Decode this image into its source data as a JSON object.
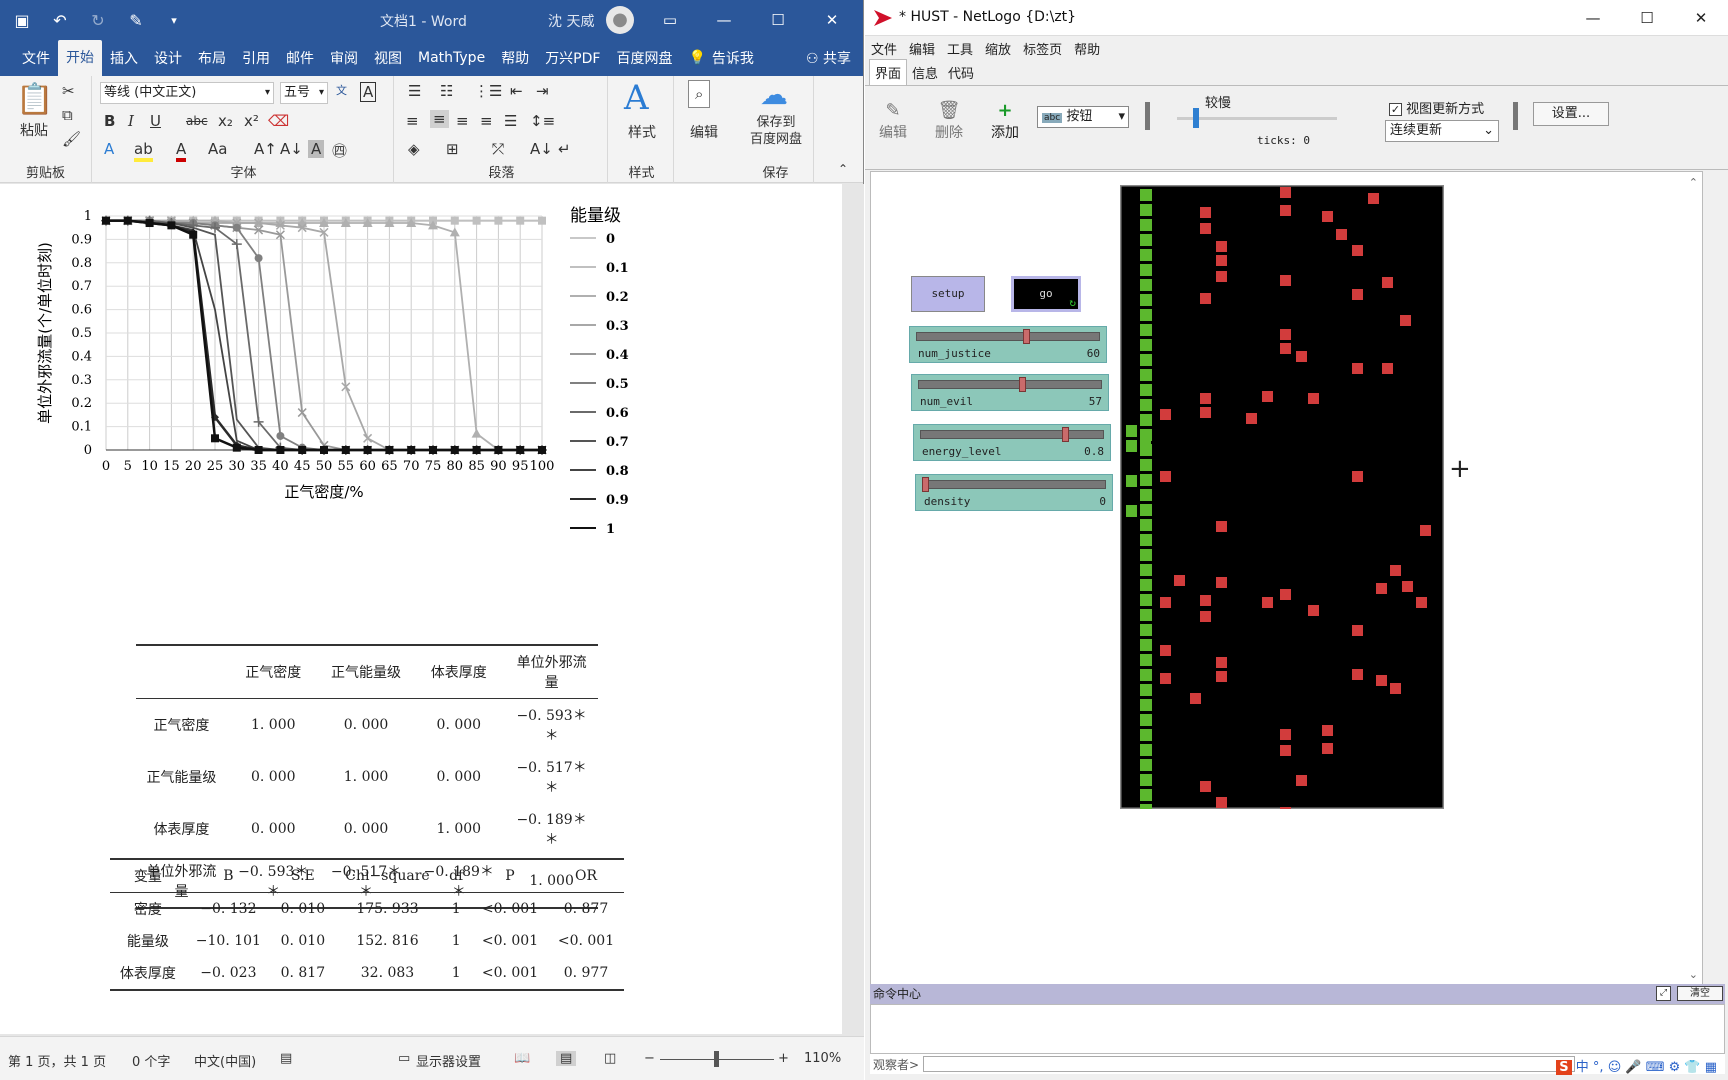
{
  "word": {
    "title": "文档1 - Word",
    "user": "沈 天威",
    "tabs": [
      "文件",
      "开始",
      "插入",
      "设计",
      "布局",
      "引用",
      "邮件",
      "审阅",
      "视图",
      "MathType",
      "帮助",
      "万兴PDF",
      "百度网盘"
    ],
    "tellme": "告诉我",
    "share": "共享",
    "font_name": "等线 (中文正文)",
    "font_size": "五号",
    "groups": {
      "clipboard": "剪贴板",
      "font": "字体",
      "paragraph": "段落",
      "styles": "样式",
      "save": "保存"
    },
    "paste": "粘贴",
    "styles_btn": "样式",
    "edit_btn": "编辑",
    "save_to_baidu": "保存到\n百度网盘",
    "status": {
      "page": "第 1 页，共 1 页",
      "words": "0 个字",
      "lang": "中文(中国)",
      "display": "显示器设置",
      "zoom": "110%"
    }
  },
  "chart_data": {
    "type": "line",
    "x": [
      0,
      5,
      10,
      15,
      20,
      25,
      30,
      35,
      40,
      45,
      50,
      55,
      60,
      65,
      70,
      75,
      80,
      85,
      90,
      95,
      100
    ],
    "xlabel": "正气密度/%",
    "ylabel": "单位外邪流量(个/单位时刻)",
    "ylim": [
      0,
      1
    ],
    "yticks": [
      "0",
      "0.1",
      "0.2",
      "0.3",
      "0.4",
      "0.5",
      "0.6",
      "0.7",
      "0.8",
      "0.9",
      "1"
    ],
    "legend_title": "能量级",
    "legend_position": "right",
    "series": [
      {
        "name": "0",
        "color": "#c8c8c8",
        "values": [
          0.98,
          0.98,
          0.98,
          0.98,
          0.98,
          0.98,
          0.98,
          0.98,
          0.98,
          0.98,
          0.98,
          0.98,
          0.98,
          0.98,
          0.98,
          0.98,
          0.98,
          0.98,
          0.98,
          0.98,
          0.98
        ]
      },
      {
        "name": "0.1",
        "color": "#c0c0c0",
        "values": [
          0.98,
          0.98,
          0.98,
          0.98,
          0.98,
          0.98,
          0.98,
          0.98,
          0.98,
          0.98,
          0.98,
          0.98,
          0.98,
          0.98,
          0.98,
          0.98,
          0.98,
          0.98,
          0.98,
          0.98,
          0.98
        ]
      },
      {
        "name": "0.2",
        "color": "#b0b0b0",
        "values": [
          0.98,
          0.98,
          0.98,
          0.98,
          0.98,
          0.98,
          0.97,
          0.97,
          0.97,
          0.97,
          0.97,
          0.97,
          0.97,
          0.97,
          0.97,
          0.96,
          0.93,
          0.07,
          0,
          0,
          0
        ]
      },
      {
        "name": "0.3",
        "color": "#a8a8a8",
        "values": [
          0.98,
          0.98,
          0.98,
          0.98,
          0.97,
          0.97,
          0.97,
          0.97,
          0.96,
          0.95,
          0.93,
          0.27,
          0.05,
          0,
          0,
          0,
          0,
          0,
          0,
          0,
          0
        ]
      },
      {
        "name": "0.4",
        "color": "#999999",
        "values": [
          0.98,
          0.98,
          0.98,
          0.97,
          0.97,
          0.96,
          0.95,
          0.94,
          0.92,
          0.16,
          0.02,
          0,
          0,
          0,
          0,
          0,
          0,
          0,
          0,
          0,
          0
        ]
      },
      {
        "name": "0.5",
        "color": "#808080",
        "values": [
          0.98,
          0.98,
          0.98,
          0.97,
          0.97,
          0.96,
          0.95,
          0.82,
          0.06,
          0.01,
          0,
          0,
          0,
          0,
          0,
          0,
          0,
          0,
          0,
          0,
          0
        ]
      },
      {
        "name": "0.6",
        "color": "#6a6a6a",
        "values": [
          0.98,
          0.98,
          0.98,
          0.97,
          0.96,
          0.95,
          0.88,
          0.12,
          0.01,
          0,
          0,
          0,
          0,
          0,
          0,
          0,
          0,
          0,
          0,
          0,
          0
        ]
      },
      {
        "name": "0.7",
        "color": "#555555",
        "values": [
          0.98,
          0.98,
          0.97,
          0.97,
          0.95,
          0.92,
          0.13,
          0.01,
          0,
          0,
          0,
          0,
          0,
          0,
          0,
          0,
          0,
          0,
          0,
          0,
          0
        ]
      },
      {
        "name": "0.8",
        "color": "#444444",
        "values": [
          0.98,
          0.98,
          0.97,
          0.96,
          0.94,
          0.6,
          0.04,
          0,
          0,
          0,
          0,
          0,
          0,
          0,
          0,
          0,
          0,
          0,
          0,
          0,
          0
        ]
      },
      {
        "name": "0.9",
        "color": "#2a2a2a",
        "values": [
          0.98,
          0.98,
          0.97,
          0.96,
          0.93,
          0.14,
          0.02,
          0,
          0,
          0,
          0,
          0,
          0,
          0,
          0,
          0,
          0,
          0,
          0,
          0,
          0
        ]
      },
      {
        "name": "1",
        "color": "#111111",
        "values": [
          0.98,
          0.98,
          0.97,
          0.96,
          0.92,
          0.05,
          0.01,
          0,
          0,
          0,
          0,
          0,
          0,
          0,
          0,
          0,
          0,
          0,
          0,
          0,
          0
        ]
      }
    ]
  },
  "table1": {
    "headers": [
      "",
      "正气密度",
      "正气能量级",
      "体表厚度",
      "单位外邪流量"
    ],
    "rows": [
      [
        "正气密度",
        "1. 000",
        "0. 000",
        "0. 000",
        "−0. 593＊＊"
      ],
      [
        "正气能量级",
        "0. 000",
        "1. 000",
        "0. 000",
        "−0. 517＊＊"
      ],
      [
        "体表厚度",
        "0. 000",
        "0. 000",
        "1. 000",
        "−0. 189＊＊"
      ],
      [
        "单位外邪流量",
        "−0. 593＊＊",
        "−0. 517＊＊",
        "−0. 189＊＊",
        "1. 000"
      ]
    ]
  },
  "table2": {
    "headers": [
      "变量",
      "B",
      "S.E",
      "Chi−square",
      "df",
      "P",
      "OR"
    ],
    "rows": [
      [
        "密度",
        "−0. 132",
        "0. 010",
        "175. 933",
        "1",
        "<0. 001",
        "0. 877"
      ],
      [
        "能量级",
        "−10. 101",
        "0. 010",
        "152. 816",
        "1",
        "<0. 001",
        "<0. 001"
      ],
      [
        "体表厚度",
        "−0. 023",
        "0. 817",
        "32. 083",
        "1",
        "<0. 001",
        "0. 977"
      ]
    ]
  },
  "netlogo": {
    "title": "* HUST - NetLogo {D:\\zt}",
    "menu": [
      "文件",
      "编辑",
      "工具",
      "缩放",
      "标签页",
      "帮助"
    ],
    "tabs": [
      "界面",
      "信息",
      "代码"
    ],
    "toolbar": {
      "edit": "编辑",
      "delete": "删除",
      "add": "添加",
      "widget_type": "按钮",
      "speed_label": "较慢",
      "ticks": "ticks: 0",
      "view_update": "视图更新方式",
      "update_mode": "连续更新",
      "settings": "设置..."
    },
    "buttons": {
      "setup": "setup",
      "go": "go"
    },
    "sliders": [
      {
        "name": "num_justice",
        "value": "60",
        "fraction": 0.6
      },
      {
        "name": "num_evil",
        "value": "57",
        "fraction": 0.57
      },
      {
        "name": "energy_level",
        "value": "0.8",
        "fraction": 0.8
      },
      {
        "name": "density",
        "value": "0",
        "fraction": 0
      }
    ],
    "command_center": "命令中心",
    "clear": "清空",
    "observer": "观察者>"
  }
}
